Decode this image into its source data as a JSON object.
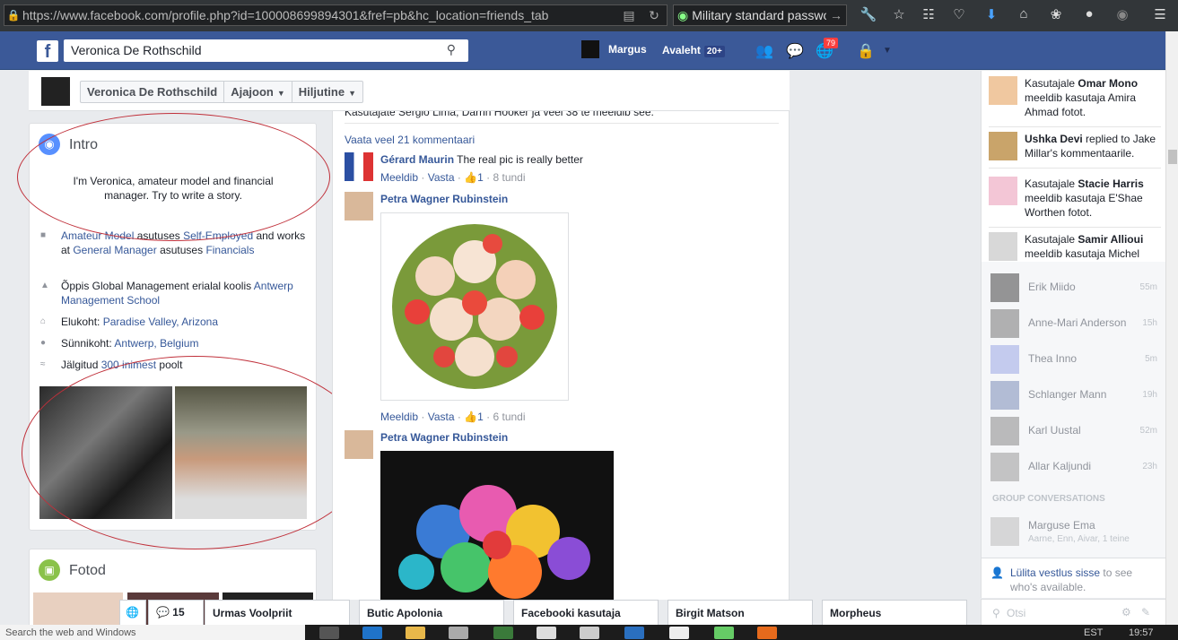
{
  "browser": {
    "url": "https://www.facebook.com/profile.php?id=100008699894301&fref=pb&hc_location=friends_tab",
    "url_host": "facebook.com",
    "search": "Military standard passwor"
  },
  "fb": {
    "logo": "f",
    "search_value": "Veronica De Rothschild",
    "user": "Margus",
    "home_label": "Avaleht",
    "home_count": "20+",
    "notif_count": "79"
  },
  "timeline_header": {
    "name": "Veronica De Rothschild",
    "tab1": "Ajajoon",
    "tab2": "Hiljutine"
  },
  "intro": {
    "title": "Intro",
    "bio": "I'm Veronica, amateur model and financial manager. Try to write a story.",
    "work_a": "Amateur Model",
    "work_b": " asutuses ",
    "work_c": "Self-Employed",
    "work_d": " and works at ",
    "work_e": "General Manager",
    "work_f": " asutuses ",
    "work_g": "Financials",
    "edu_a": "Õppis Global Management erialal koolis ",
    "edu_b": "Antwerp Management School",
    "live_a": "Elukoht: ",
    "live_b": "Paradise Valley, Arizona",
    "born_a": "Sünnikoht: ",
    "born_b": "Antwerp, Belgium",
    "follow_a": "Jälgitud ",
    "follow_b": "300 inimest",
    "follow_c": " poolt"
  },
  "fotod": {
    "title": "Fotod"
  },
  "feed": {
    "clipped": "Kasutajate Sergio Lima, Darrin Hooker ja veel 38 te meeldib see.",
    "more_comments": "Vaata veel 21 kommentaari",
    "c1_name": "Gérard Maurin",
    "c1_text": " The real pic is really better",
    "c1_like": "Meeldib",
    "c1_reply": "Vasta",
    "c1_count": "1",
    "c1_time": "8 tundi",
    "c2_name": "Petra Wagner Rubinstein",
    "c2_like": "Meeldib",
    "c2_reply": "Vasta",
    "c2_count": "1",
    "c2_time": "6 tundi",
    "c3_name": "Petra Wagner Rubinstein"
  },
  "ticker": [
    {
      "a": "Kasutajale ",
      "b": "Omar Mono",
      "c": " meeldib kasutaja Amira Ahmad fotot."
    },
    {
      "a": "",
      "b": "Ushka Devi",
      "c": " replied to Jake Millar's kommentaarile."
    },
    {
      "a": "Kasutajale ",
      "b": "Stacie Harris",
      "c": " meeldib kasutaja E'Shae Worthen fotot."
    },
    {
      "a": "Kasutajale ",
      "b": "Samir Allioui",
      "c": " meeldib kasutaja Michel"
    }
  ],
  "chat": [
    {
      "name": "Erik Miido",
      "time": "55m"
    },
    {
      "name": "Anne-Mari Anderson",
      "time": "15h"
    },
    {
      "name": "Thea Inno",
      "time": "5m"
    },
    {
      "name": "Schlanger Mann",
      "time": "19h"
    },
    {
      "name": "Karl Uustal",
      "time": "52m"
    },
    {
      "name": "Allar Kaljundi",
      "time": "23h"
    }
  ],
  "group_label": "GROUP CONVERSATIONS",
  "group": {
    "name": "Marguse Ema",
    "members": "Aarne, Enn, Aivar, 1 teine"
  },
  "toggle": {
    "link": "Lülita vestlus sisse",
    "rest": " to see who's available."
  },
  "chat_search": "Otsi",
  "chat_tabs": {
    "count": "15",
    "t1": "Urmas Voolpriit",
    "t2": "Butic Apolonia",
    "t3": "Facebooki kasutaja",
    "t4": "Birgit Matson",
    "t5": "Morpheus"
  },
  "taskbar": {
    "search": "Search the web and Windows",
    "lang": "EST",
    "time": "19:57"
  }
}
